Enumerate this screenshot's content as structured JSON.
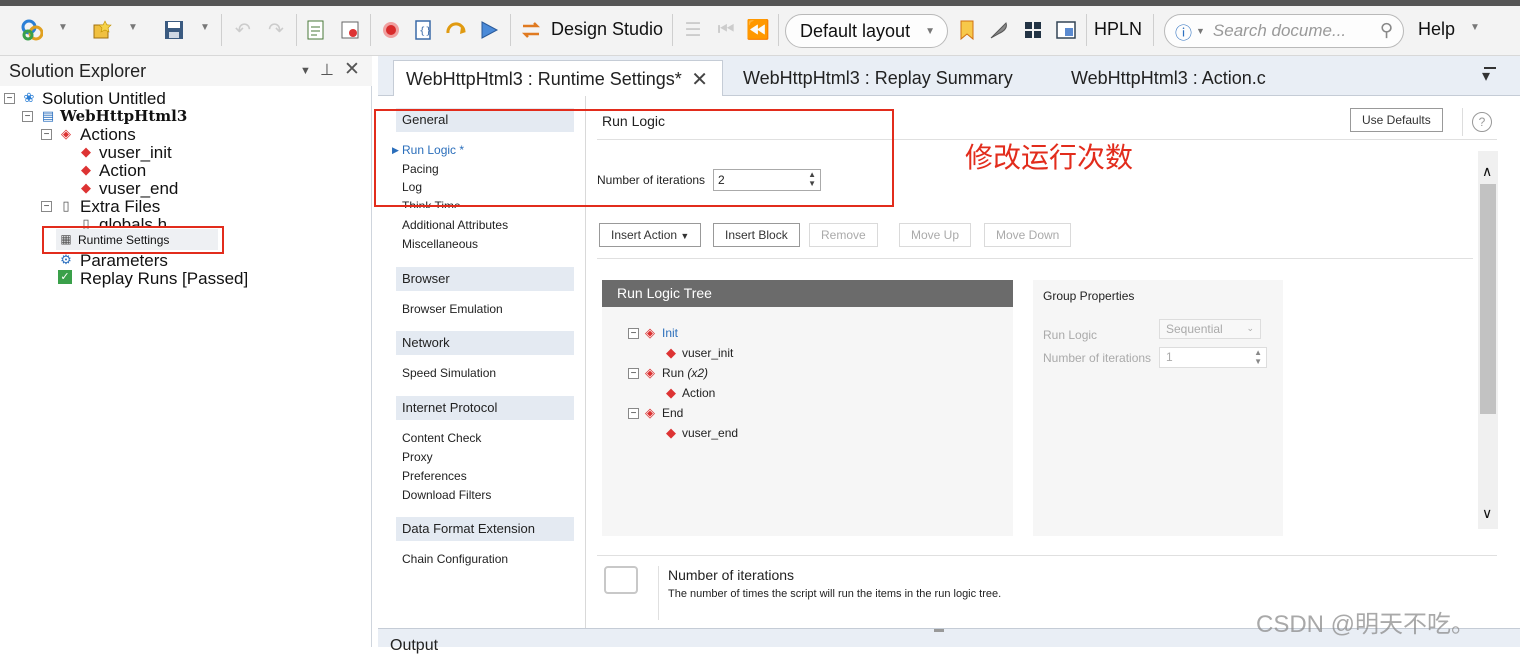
{
  "toolbar": {
    "design_studio_label": "Design Studio",
    "layout_combo": "Default layout",
    "hpln_label": "HPLN",
    "search_placeholder": "Search docume...",
    "help_label": "Help"
  },
  "solution_explorer": {
    "title": "Solution Explorer",
    "pin_icon": "pin-icon",
    "close_icon": "close-icon",
    "tree": {
      "solution": "Solution Untitled",
      "project": "WebHttpHtml3",
      "actions_folder": "Actions",
      "actions": [
        "vuser_init",
        "Action",
        "vuser_end"
      ],
      "extra_files": "Extra Files",
      "globals": "globals.h",
      "runtime_settings": "Runtime Settings",
      "parameters": "Parameters",
      "replay_runs": "Replay Runs [Passed]"
    }
  },
  "tabs": [
    {
      "label": "WebHttpHtml3 : Runtime Settings*",
      "active": true
    },
    {
      "label": "WebHttpHtml3 : Replay Summary",
      "active": false
    },
    {
      "label": "WebHttpHtml3 : Action.c",
      "active": false
    }
  ],
  "settings_nav": {
    "sections": [
      {
        "header": "General",
        "items": [
          "Run Logic *",
          "Pacing",
          "Log",
          "Think Time",
          "Additional Attributes",
          "Miscellaneous"
        ]
      },
      {
        "header": "Browser",
        "items": [
          "Browser Emulation"
        ]
      },
      {
        "header": "Network",
        "items": [
          "Speed Simulation"
        ]
      },
      {
        "header": "Internet Protocol",
        "items": [
          "Content Check",
          "Proxy",
          "Preferences",
          "Download Filters"
        ]
      },
      {
        "header": "Data Format Extension",
        "items": [
          "Chain Configuration"
        ]
      }
    ]
  },
  "run_logic": {
    "title": "Run Logic",
    "use_defaults": "Use Defaults",
    "iterations_label": "Number of iterations",
    "iterations_value": "2",
    "annotation": "修改运行次数",
    "buttons": {
      "insert_action": "Insert Action",
      "insert_block": "Insert Block",
      "remove": "Remove",
      "move_up": "Move Up",
      "move_down": "Move Down"
    },
    "tree_title": "Run Logic Tree",
    "tree": {
      "init": "Init",
      "init_child": "vuser_init",
      "run": "Run",
      "run_suffix": "(x2)",
      "run_child": "Action",
      "end": "End",
      "end_child": "vuser_end"
    },
    "group_properties": {
      "title": "Group Properties",
      "run_logic_label": "Run Logic",
      "run_logic_value": "Sequential",
      "iterations_label": "Number of iterations",
      "iterations_value": "1"
    },
    "help": {
      "title": "Number of iterations",
      "text": "The number of times the script will run the items in the run logic tree."
    }
  },
  "output_label": "Output",
  "watermark": "CSDN @明天不吃。",
  "colors": {
    "highlight_red": "#e22c1c",
    "link_blue": "#2a6ebb",
    "tree_header": "#6b6b6b"
  }
}
